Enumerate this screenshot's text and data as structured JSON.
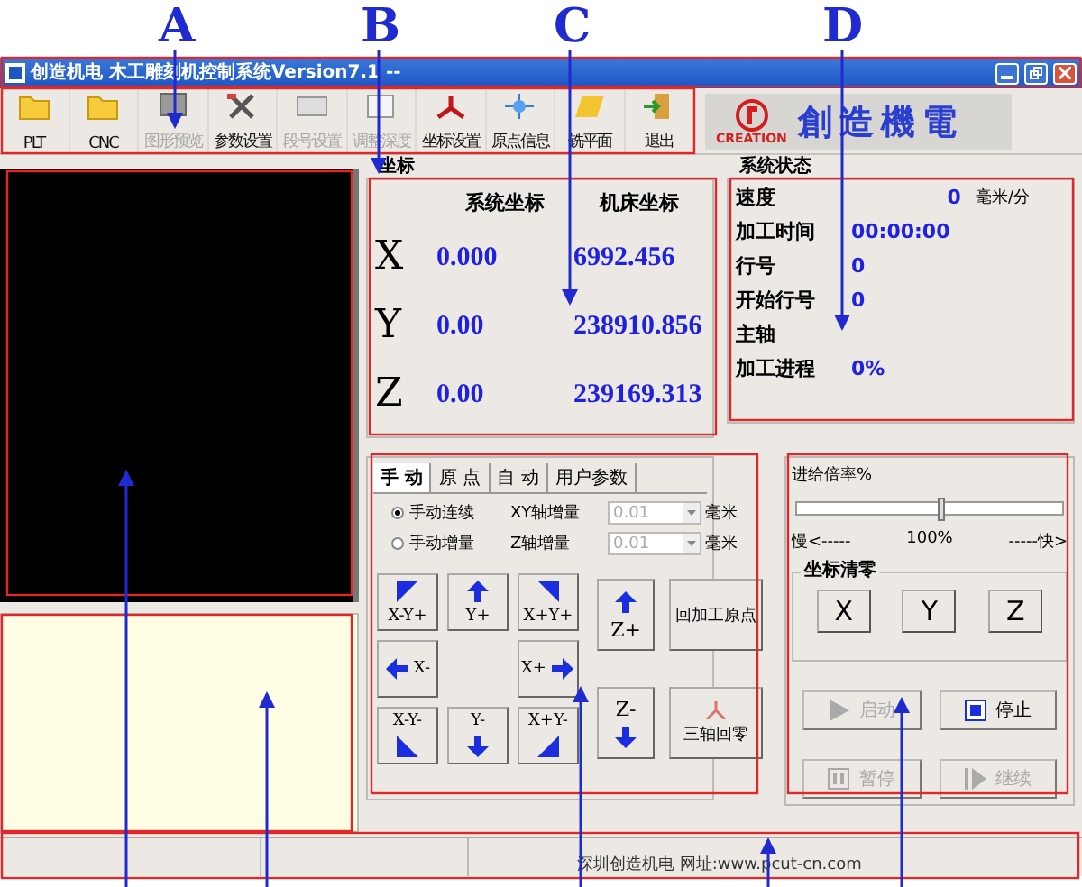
{
  "annotations": {
    "labels": [
      "A",
      "B",
      "C",
      "D"
    ]
  },
  "window": {
    "title": "创造机电 木工雕刻机控制系统Version7.1 --"
  },
  "toolbar": [
    {
      "label": "PLT",
      "kind": "folder",
      "disabled": false
    },
    {
      "label": "CNC",
      "kind": "folder",
      "disabled": false
    },
    {
      "label": "图形预览",
      "kind": "preview",
      "disabled": true
    },
    {
      "label": "参数设置",
      "kind": "tools",
      "disabled": false
    },
    {
      "label": "段号设置",
      "kind": "reset",
      "disabled": true
    },
    {
      "label": "调整深度",
      "kind": "depth",
      "disabled": true
    },
    {
      "label": "坐标设置",
      "kind": "axes",
      "disabled": false
    },
    {
      "label": "原点信息",
      "kind": "origin",
      "disabled": false
    },
    {
      "label": "铣平面",
      "kind": "plane",
      "disabled": false
    },
    {
      "label": "退出",
      "kind": "exit",
      "disabled": false
    }
  ],
  "logo": {
    "brand": "CREATION",
    "name": "創造機電"
  },
  "coordinates": {
    "title": "坐标",
    "columns": [
      "系统坐标",
      "机床坐标"
    ],
    "rows": [
      {
        "axis": "X",
        "system": "0.000",
        "machine": "6992.456"
      },
      {
        "axis": "Y",
        "system": "0.00",
        "machine": "238910.856"
      },
      {
        "axis": "Z",
        "system": "0.00",
        "machine": "239169.313"
      }
    ]
  },
  "status": {
    "title": "系统状态",
    "rows": [
      {
        "label": "速度",
        "value": "0",
        "unit": "毫米/分"
      },
      {
        "label": "加工时间",
        "value": "00:00:00"
      },
      {
        "label": "行号",
        "value": "0"
      },
      {
        "label": "开始行号",
        "value": "0"
      },
      {
        "label": "主轴"
      },
      {
        "label": "加工进程",
        "value": "0%"
      }
    ]
  },
  "manual": {
    "tabs": [
      {
        "label": "手 动",
        "selected": true
      },
      {
        "label": "原 点",
        "selected": false
      },
      {
        "label": "自 动",
        "selected": false
      },
      {
        "label": "用户参数",
        "selected": false
      }
    ],
    "modes": [
      {
        "label": "手动连续",
        "selected": true
      },
      {
        "label": "手动增量",
        "selected": false
      }
    ],
    "increments": [
      {
        "label": "XY轴增量",
        "value": "0.01",
        "unit": "毫米",
        "disabled": true
      },
      {
        "label": "Z轴增量",
        "value": "0.01",
        "unit": "毫米",
        "disabled": true
      }
    ],
    "jog": [
      {
        "label": "X-Y+",
        "kind": "nw"
      },
      {
        "label": "Y+",
        "kind": "n"
      },
      {
        "label": "X+Y+",
        "kind": "ne"
      },
      {
        "label": "X-",
        "kind": "w"
      },
      {
        "label": "X+",
        "kind": "e"
      },
      {
        "label": "X-Y-",
        "kind": "sw"
      },
      {
        "label": "Y-",
        "kind": "s"
      },
      {
        "label": "X+Y-",
        "kind": "se"
      }
    ],
    "z_buttons": [
      {
        "label": "Z+",
        "kind": "up"
      },
      {
        "label": "Z-",
        "kind": "down"
      }
    ],
    "actions": [
      {
        "label": "回加工原点",
        "kind": "plain"
      },
      {
        "label": "三轴回零",
        "kind": "tripod"
      }
    ]
  },
  "feed": {
    "title": "进给倍率%",
    "level": 0.53,
    "slow": "慢<-----",
    "reading": "100%",
    "fast": "-----快>"
  },
  "zero": {
    "title": "坐标清零",
    "buttons": [
      "X",
      "Y",
      "Z"
    ]
  },
  "run": [
    {
      "label": "启动",
      "kind": "play",
      "disabled": true
    },
    {
      "label": "停止",
      "kind": "stop",
      "disabled": false
    },
    {
      "label": "暂停",
      "kind": "pause",
      "disabled": true
    },
    {
      "label": "继续",
      "kind": "resume",
      "disabled": true
    }
  ],
  "status_bar": {
    "text": "深圳创造机电 网址:www.pcut-cn.com"
  }
}
